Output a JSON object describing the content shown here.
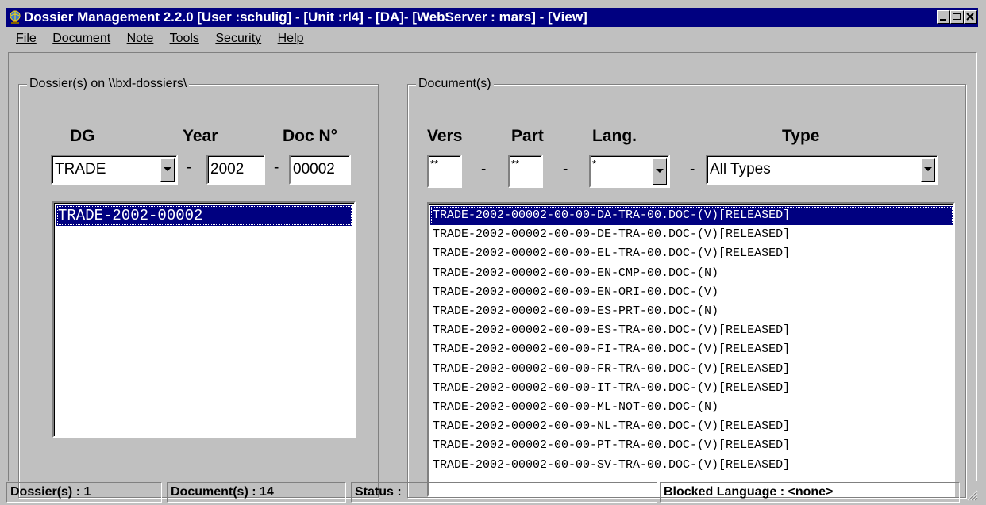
{
  "window": {
    "title": "Dossier Management 2.2.0 [User :schulig] - [Unit :rl4] - [DA]- [WebServer : mars] - [View]"
  },
  "menu": [
    "File",
    "Document",
    "Note",
    "Tools",
    "Security",
    "Help"
  ],
  "dossiers": {
    "legend": "Dossier(s) on \\\\bxl-dossiers\\",
    "headers": {
      "dg": "DG",
      "year": "Year",
      "docno": "Doc N°"
    },
    "dg_value": "TRADE",
    "year_value": "2002",
    "docno_value": "00002",
    "separator": "-",
    "items": [
      "TRADE-2002-00002"
    ],
    "selected_index": 0
  },
  "documents": {
    "legend": "Document(s)",
    "headers": {
      "vers": "Vers",
      "part": "Part",
      "lang": "Lang.",
      "type": "Type"
    },
    "vers_value": "**",
    "part_value": "**",
    "lang_value": "*",
    "type_value": "All Types",
    "separator": "-",
    "items": [
      "TRADE-2002-00002-00-00-DA-TRA-00.DOC-(V)[RELEASED]",
      "TRADE-2002-00002-00-00-DE-TRA-00.DOC-(V)[RELEASED]",
      "TRADE-2002-00002-00-00-EL-TRA-00.DOC-(V)[RELEASED]",
      "TRADE-2002-00002-00-00-EN-CMP-00.DOC-(N)",
      "TRADE-2002-00002-00-00-EN-ORI-00.DOC-(V)",
      "TRADE-2002-00002-00-00-ES-PRT-00.DOC-(N)",
      "TRADE-2002-00002-00-00-ES-TRA-00.DOC-(V)[RELEASED]",
      "TRADE-2002-00002-00-00-FI-TRA-00.DOC-(V)[RELEASED]",
      "TRADE-2002-00002-00-00-FR-TRA-00.DOC-(V)[RELEASED]",
      "TRADE-2002-00002-00-00-IT-TRA-00.DOC-(V)[RELEASED]",
      "TRADE-2002-00002-00-00-ML-NOT-00.DOC-(N)",
      "TRADE-2002-00002-00-00-NL-TRA-00.DOC-(V)[RELEASED]",
      "TRADE-2002-00002-00-00-PT-TRA-00.DOC-(V)[RELEASED]",
      "TRADE-2002-00002-00-00-SV-TRA-00.DOC-(V)[RELEASED]"
    ],
    "selected_index": 0
  },
  "status": {
    "dossiers": "Dossier(s) : 1",
    "documents": "Document(s) : 14",
    "status": "Status :",
    "blocked": "Blocked Language : <none>"
  },
  "colors": {
    "face": "#c0c0c0",
    "title_bg": "#000080",
    "selection": "#000080"
  },
  "icons": {
    "app": "globe-icon",
    "minimize": "minimize-icon",
    "maximize": "maximize-icon",
    "close": "close-icon",
    "dropdown": "chevron-down-icon",
    "grip": "resize-grip-icon"
  }
}
